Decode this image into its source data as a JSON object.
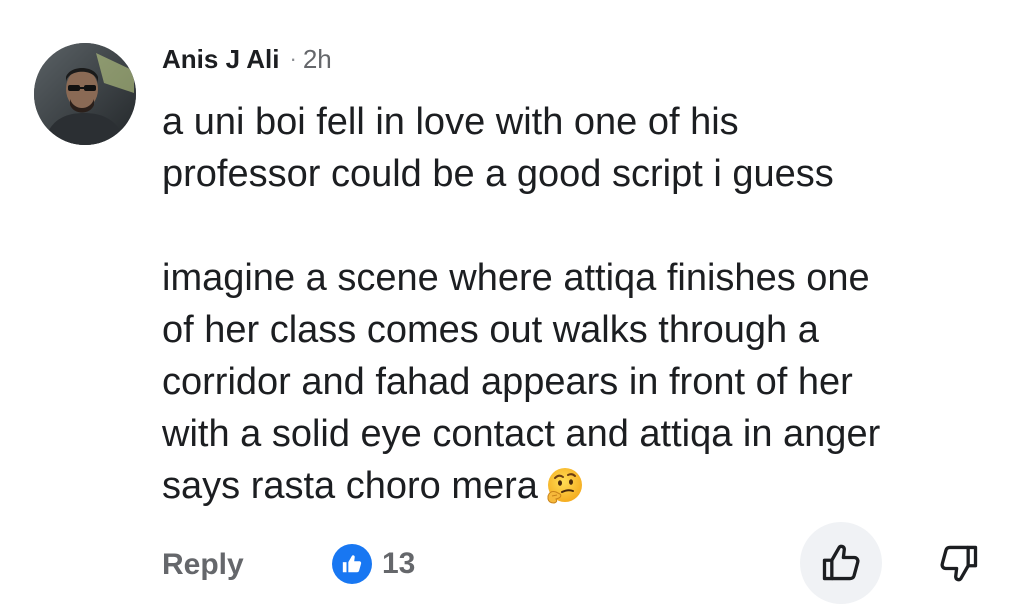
{
  "comment": {
    "author": "Anis J Ali",
    "separator": "·",
    "time": "2h",
    "paragraphs": [
      [
        "a uni boi fell in love with one of his",
        "professor could be a good script i guess"
      ],
      [
        "imagine a scene where attiqa finishes one",
        "of her class comes out walks through a",
        "corridor and fahad appears in front of her",
        "with a solid eye contact and attiqa in anger",
        "says rasta choro mera"
      ]
    ],
    "emoji": "thinking-face"
  },
  "actions": {
    "reply_label": "Reply",
    "reaction_count": "13",
    "reaction_icon": "like-reaction-icon",
    "like_icon": "thumbs-up-outline-icon",
    "dislike_icon": "thumbs-down-outline-icon"
  },
  "colors": {
    "text": "#1c1e21",
    "secondary": "#65676b",
    "like_blue": "#1877f2",
    "button_bg": "#f0f2f5"
  }
}
